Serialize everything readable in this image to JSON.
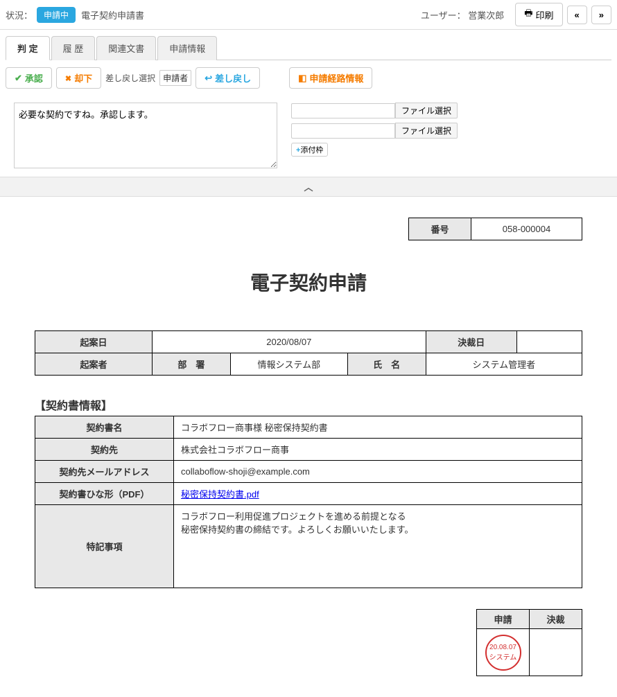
{
  "header": {
    "status_label": "状況：",
    "status_badge": "申請中",
    "doc_title": "電子契約申請書",
    "user_label": "ユーザー：",
    "user_name": "営業次郎",
    "print_label": "印刷"
  },
  "tabs": {
    "judgment": "判 定",
    "history": "履 歴",
    "related": "関連文書",
    "info": "申請情報"
  },
  "actions": {
    "approve": "承認",
    "reject": "却下",
    "remand_select_label": "差し戻し選択",
    "remand_select_value": "申請者",
    "remand": "差し戻し",
    "route_info": "申請経路情報",
    "comment_value": "必要な契約ですね。承認します。",
    "file_select": "ファイル選択",
    "add_attachment": "添付枠"
  },
  "document": {
    "number_label": "番号",
    "number_value": "058-000004",
    "heading": "電子契約申請",
    "draft_date_label": "起案日",
    "draft_date_value": "2020/08/07",
    "approval_date_label": "決裁日",
    "approval_date_value": "",
    "drafter_label": "起案者",
    "department_label": "部　署",
    "department_value": "情報システム部",
    "name_label": "氏　名",
    "name_value": "システム管理者",
    "section_title": "【契約書情報】",
    "contract": {
      "name_label": "契約書名",
      "name_value": "コラボフロー商事様 秘密保持契約書",
      "party_label": "契約先",
      "party_value": "株式会社コラボフロー商事",
      "email_label": "契約先メールアドレス",
      "email_value": "collaboflow-shoji@example.com",
      "template_label": "契約書ひな形（PDF）",
      "template_link": "秘密保持契約書.pdf",
      "notes_label": "特記事項",
      "notes_line1": "コラボフロー利用促進プロジェクトを進める前提となる",
      "notes_line2": "秘密保持契約書の締結です。よろしくお願いいたします。"
    },
    "stamp": {
      "apply_label": "申請",
      "approve_label": "決裁",
      "date": "20.08.07",
      "name": "システム"
    }
  }
}
